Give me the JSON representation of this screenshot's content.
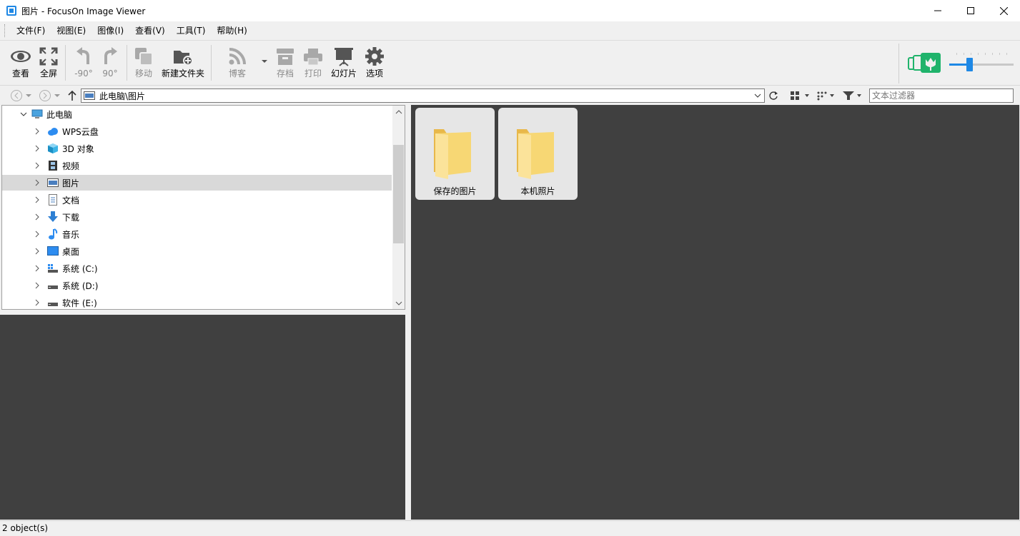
{
  "window": {
    "title": "图片 - FocusOn Image Viewer"
  },
  "menu": [
    {
      "label": "文件(F)"
    },
    {
      "label": "视图(E)"
    },
    {
      "label": "图像(I)"
    },
    {
      "label": "查看(V)"
    },
    {
      "label": "工具(T)"
    },
    {
      "label": "帮助(H)"
    }
  ],
  "toolbar": {
    "view": "查看",
    "fullscreen": "全屏",
    "rotate_left": "-90°",
    "rotate_right": "90°",
    "move": "移动",
    "new_folder": "新建文件夹",
    "blog": "博客",
    "archive": "存档",
    "print": "打印",
    "slideshow": "幻灯片",
    "options": "选项",
    "zoom_level": 0.3
  },
  "address": {
    "path": "此电脑\\图片",
    "filter_placeholder": "文本过滤器"
  },
  "tree": [
    {
      "label": "此电脑",
      "icon": "computer-icon",
      "expanded": true
    },
    {
      "label": "WPS云盘",
      "icon": "cloud-icon"
    },
    {
      "label": "3D 对象",
      "icon": "cube-icon"
    },
    {
      "label": "视频",
      "icon": "film-icon"
    },
    {
      "label": "图片",
      "icon": "pictures-icon",
      "selected": true
    },
    {
      "label": "文档",
      "icon": "document-icon"
    },
    {
      "label": "下载",
      "icon": "download-icon"
    },
    {
      "label": "音乐",
      "icon": "music-icon"
    },
    {
      "label": "桌面",
      "icon": "desktop-icon"
    },
    {
      "label": "系统 (C:)",
      "icon": "drive-icon"
    },
    {
      "label": "系统 (D:)",
      "icon": "drive-icon"
    },
    {
      "label": "软件 (E:)",
      "icon": "drive-icon"
    }
  ],
  "thumbnails": [
    {
      "label": "保存的图片",
      "icon": "folder-icon"
    },
    {
      "label": "本机照片",
      "icon": "folder-icon"
    }
  ],
  "status": {
    "text": "2 object(s)"
  },
  "colors": {
    "accent": "#1e88e5",
    "panel_dark": "#404040",
    "folder": "#f7d774"
  }
}
